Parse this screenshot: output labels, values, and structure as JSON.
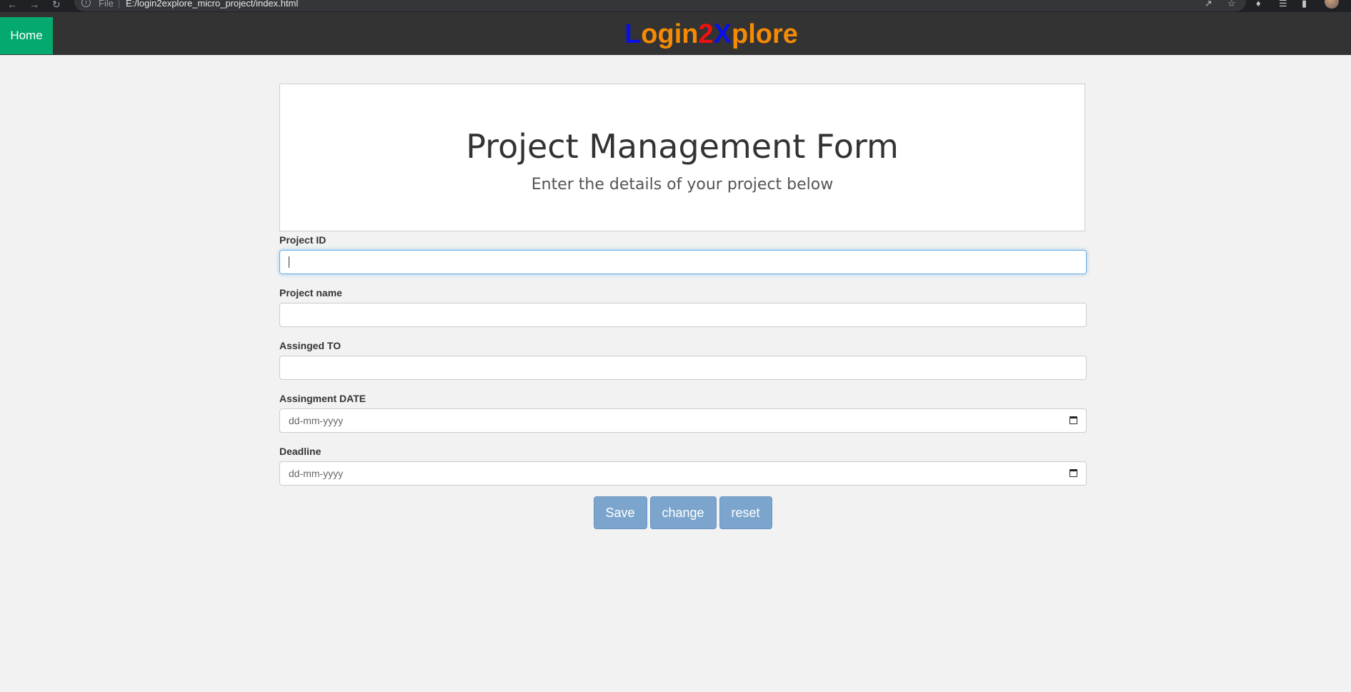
{
  "browser": {
    "scheme_label": "File",
    "url": "E:/login2explore_micro_project/index.html",
    "back_icon": "arrow-left-icon",
    "forward_icon": "arrow-right-icon",
    "reload_icon": "reload-icon"
  },
  "header": {
    "home_label": "Home",
    "logo_parts": [
      "L",
      "ogin",
      "2",
      "X",
      "plore"
    ],
    "colors": {
      "header_bg": "#333333",
      "home_bg": "#04aa6d",
      "logo_blue": "#0a10e6",
      "logo_orange": "#f58a05",
      "logo_red": "#ee1111"
    }
  },
  "jumbotron": {
    "title": "Project Management Form",
    "subtitle": "Enter the details of your project below"
  },
  "form": {
    "fields": [
      {
        "label": "Project ID",
        "value": ""
      },
      {
        "label": "Project name",
        "value": ""
      },
      {
        "label": "Assinged TO",
        "value": ""
      },
      {
        "label": "Assingment DATE",
        "placeholder": "dd-mm-yyyy"
      },
      {
        "label": "Deadline",
        "placeholder": "dd-mm-yyyy"
      }
    ],
    "buttons": {
      "save": "Save",
      "change": "change",
      "reset": "reset"
    },
    "colors": {
      "button_bg": "#7ca5cd"
    }
  }
}
